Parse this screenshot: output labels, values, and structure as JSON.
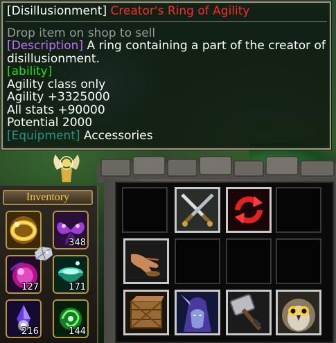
{
  "tooltip": {
    "item_prefix": "[Disillusionment]",
    "item_name": "Creator's Ring of Agility",
    "hint": "Drop item on shop to sell",
    "description_tag": "[Description]",
    "description_text": "A ring containing a part of the creator of disillusionment.",
    "ability_tag": "[ability]",
    "lines": [
      "Agility class only",
      "Agility +3325000",
      "All stats +90000",
      "Potential 2000"
    ],
    "equipment_tag": "[Equipment]",
    "equipment_value": "Accessories",
    "colors": {
      "item_name": "#ff2a2a",
      "hint": "#9a9a9a",
      "description_tag": "#c070ff",
      "ability_tag": "#22dd22",
      "equipment_tag": "#2a8f88"
    }
  },
  "inventory": {
    "title": "Inventory",
    "slots": [
      {
        "icon": "golden-ring-icon",
        "count": ""
      },
      {
        "icon": "purple-butterfly-icon",
        "count": "348"
      },
      {
        "icon": "magenta-orb-icon",
        "count": "127"
      },
      {
        "icon": "green-potion-bowl-icon",
        "count": "171"
      },
      {
        "icon": "violet-crystal-icon",
        "count": "216"
      },
      {
        "icon": "green-swirl-icon",
        "count": "144"
      }
    ]
  },
  "command_card": {
    "slots": [
      {
        "icon": "crossed-swords-icon"
      },
      {
        "icon": "red-cycle-arrows-icon"
      },
      {
        "icon": ""
      },
      {
        "icon": ""
      },
      {
        "icon": "reaching-hand-icon"
      },
      {
        "icon": ""
      },
      {
        "icon": ""
      },
      {
        "icon": ""
      },
      {
        "icon": "wooden-crate-icon"
      },
      {
        "icon": "hooded-elf-portrait-icon"
      },
      {
        "icon": "war-hammer-icon"
      },
      {
        "icon": "owl-portrait-icon"
      }
    ]
  }
}
